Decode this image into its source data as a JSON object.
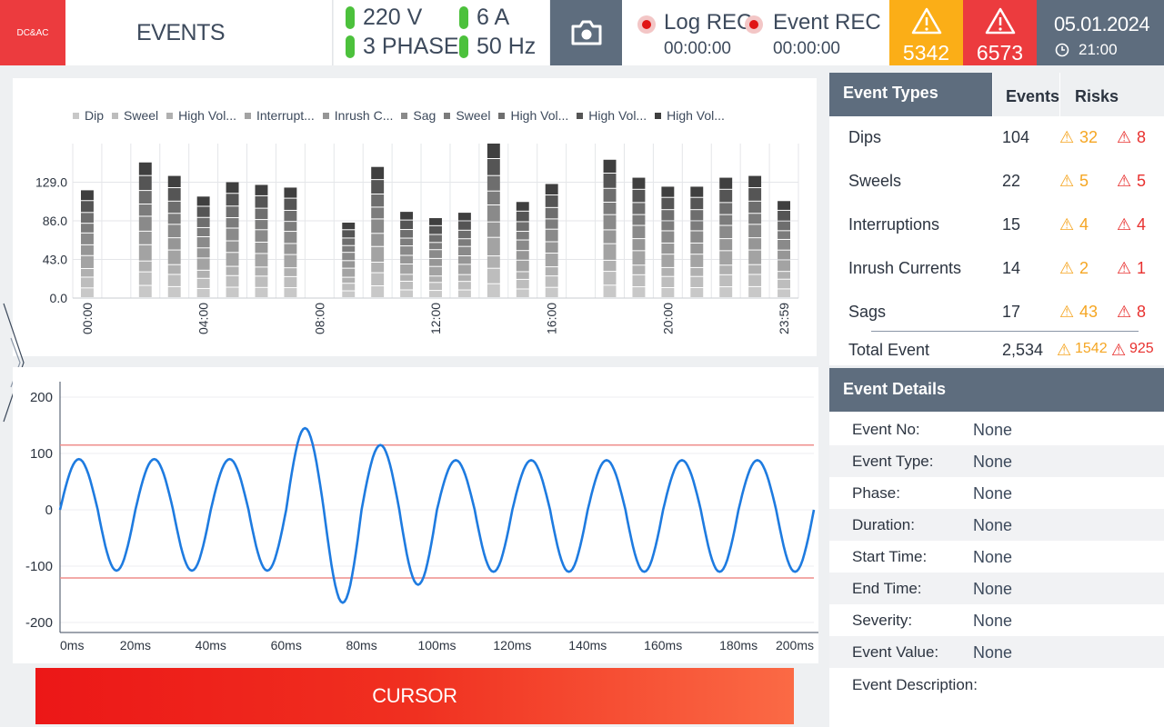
{
  "header": {
    "logo_text": "DC&AC",
    "title": "EVENTS",
    "voltage": "220 V",
    "current": "6 A",
    "phase": "3 PHASE",
    "frequency": "50 Hz",
    "camera_icon": "camera-icon",
    "log_rec_label": "Log REC",
    "log_rec_time": "00:00:00",
    "event_rec_label": "Event REC",
    "event_rec_time": "00:00:00",
    "warning_count": "5342",
    "alarm_count": "6573",
    "date": "05.01.2024",
    "time": "21:00",
    "colors": {
      "warning": "#fbae17",
      "alarm": "#ec3b3e",
      "ok": "#4cc13c",
      "slate": "#5e6d7e"
    }
  },
  "chart_data": [
    {
      "type": "bar",
      "stacked": true,
      "legend": [
        "Dip",
        "Sweel",
        "High Vol...",
        "Interrupt...",
        "Inrush C...",
        "Sag",
        "Sweel",
        "High Vol...",
        "High Vol...",
        "High Vol..."
      ],
      "legend_colors": [
        "#c8c8c8",
        "#bdbdbd",
        "#b0b0b0",
        "#a3a3a3",
        "#969696",
        "#8a8a8a",
        "#7c7c7c",
        "#6e6e6e",
        "#555555",
        "#3f3f3f"
      ],
      "x_ticks": [
        "00:00",
        "04:00",
        "08:00",
        "12:00",
        "16:00",
        "20:00",
        "23:59"
      ],
      "y_ticks": [
        "0.0",
        "43.0",
        "86.0",
        "129.0"
      ],
      "ylim": [
        0,
        172
      ],
      "totals": [
        120,
        0,
        151,
        136,
        113,
        129,
        126,
        123,
        0,
        84,
        146,
        96,
        89,
        95,
        172,
        107,
        127,
        0,
        154,
        134,
        124,
        124,
        134,
        136,
        108
      ],
      "legend_position": "top"
    },
    {
      "type": "line",
      "x_ticks": [
        "0ms",
        "20ms",
        "40ms",
        "60ms",
        "80ms",
        "100ms",
        "120ms",
        "140ms",
        "160ms",
        "180ms",
        "200ms"
      ],
      "y_ticks": [
        "200",
        "100",
        "0",
        "-100",
        "-200"
      ],
      "ylim": [
        -200,
        200
      ],
      "xlim": [
        0,
        200
      ],
      "thresholds": [
        115,
        -121
      ],
      "series": [
        {
          "x": [
            0,
            5,
            10,
            15,
            20,
            25,
            30,
            35,
            40,
            45,
            50,
            55,
            60,
            65,
            70,
            75,
            80,
            85,
            90,
            95,
            100,
            105,
            110,
            115,
            120,
            125,
            130,
            135,
            140,
            145,
            150,
            155,
            160,
            165,
            170,
            175,
            180,
            185,
            190,
            195,
            200
          ],
          "y": [
            0,
            90,
            0,
            -108,
            0,
            90,
            0,
            -108,
            0,
            90,
            0,
            -108,
            0,
            145,
            0,
            -165,
            0,
            115,
            0,
            -133,
            0,
            88,
            0,
            -110,
            0,
            88,
            0,
            -110,
            0,
            88,
            0,
            -110,
            0,
            88,
            0,
            -110,
            0,
            88,
            0,
            -110,
            0
          ],
          "color": "#1e7be0"
        }
      ]
    }
  ],
  "event_types": {
    "headers": {
      "type": "Event Types",
      "events": "Events",
      "risks": "Risks"
    },
    "rows": [
      {
        "name": "Dips",
        "events": "104",
        "warn": "32",
        "alarm": "8"
      },
      {
        "name": "Sweels",
        "events": "22",
        "warn": "5",
        "alarm": "5"
      },
      {
        "name": "Interruptions",
        "events": "15",
        "warn": "4",
        "alarm": "4"
      },
      {
        "name": "Inrush Currents",
        "events": "14",
        "warn": "2",
        "alarm": "1"
      },
      {
        "name": "Sags",
        "events": "17",
        "warn": "43",
        "alarm": "8"
      }
    ],
    "total": {
      "name": "Total Event",
      "events": "2,534",
      "warn": "1542",
      "alarm": "925"
    }
  },
  "event_details": {
    "header": "Event Details",
    "rows": [
      {
        "label": "Event No:",
        "value": "None"
      },
      {
        "label": "Event Type:",
        "value": "None"
      },
      {
        "label": "Phase:",
        "value": "None"
      },
      {
        "label": "Duration:",
        "value": "None"
      },
      {
        "label": "Start Time:",
        "value": "None"
      },
      {
        "label": "End Time:",
        "value": "None"
      },
      {
        "label": "Severity:",
        "value": "None"
      },
      {
        "label": "Event Value:",
        "value": "None"
      },
      {
        "label": "Event Description:",
        "value": ""
      }
    ]
  },
  "cursor_button": "CURSOR"
}
